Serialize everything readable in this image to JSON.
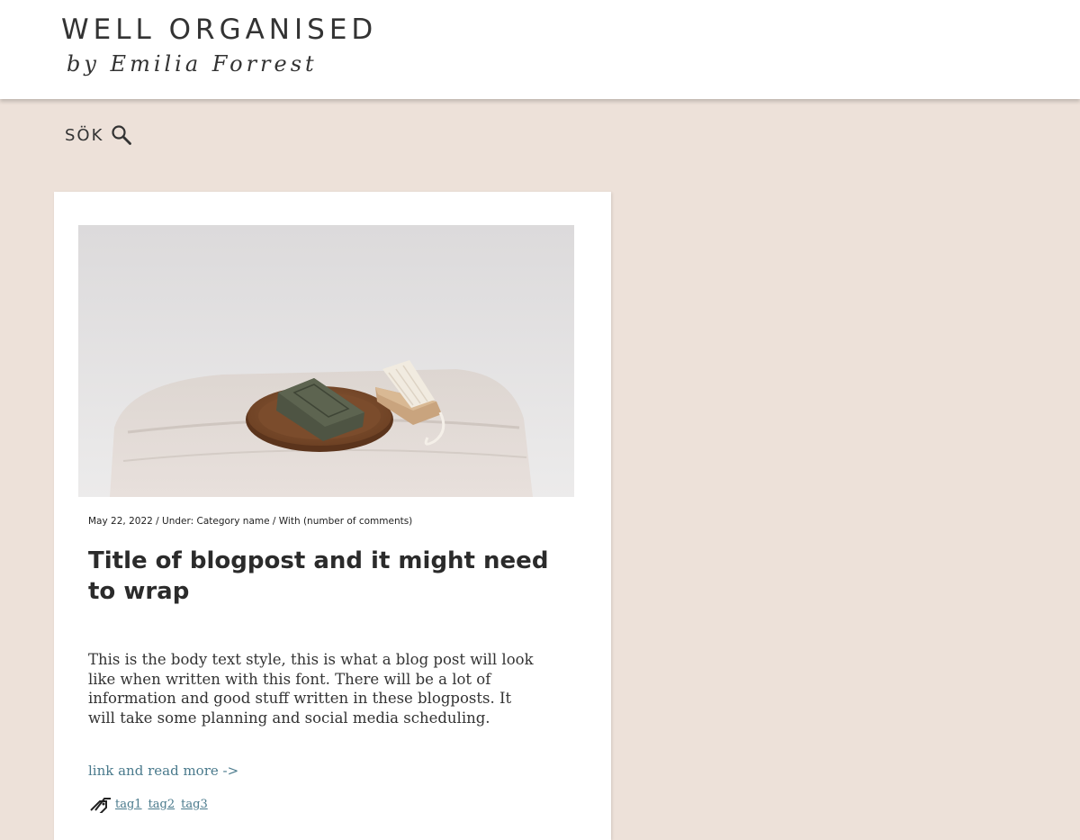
{
  "header": {
    "title": "WELL ORGANISED",
    "subtitle": "by Emilia Forrest"
  },
  "search": {
    "label": "SÖK",
    "icon": "search-icon"
  },
  "post": {
    "image_icon": "photo-soap-brush",
    "meta": "May 22, 2022  / Under: Category name / With (number of comments)",
    "title": "Title of blogpost and it might need to wrap",
    "body": "This is the body text style, this is what a blog post will look like when written with this font. There will be a lot of information and good stuff written in these blogposts. It will take some planning and social media scheduling.",
    "read_more": "link and read more ->",
    "tag_icon": "tag-icon",
    "tags": [
      "tag1",
      "tag2",
      "tag3"
    ]
  },
  "colors": {
    "background": "#ede1d9",
    "header": "#ffffff",
    "card": "#ffffff",
    "link": "#4a7a8c",
    "text": "#333333"
  }
}
